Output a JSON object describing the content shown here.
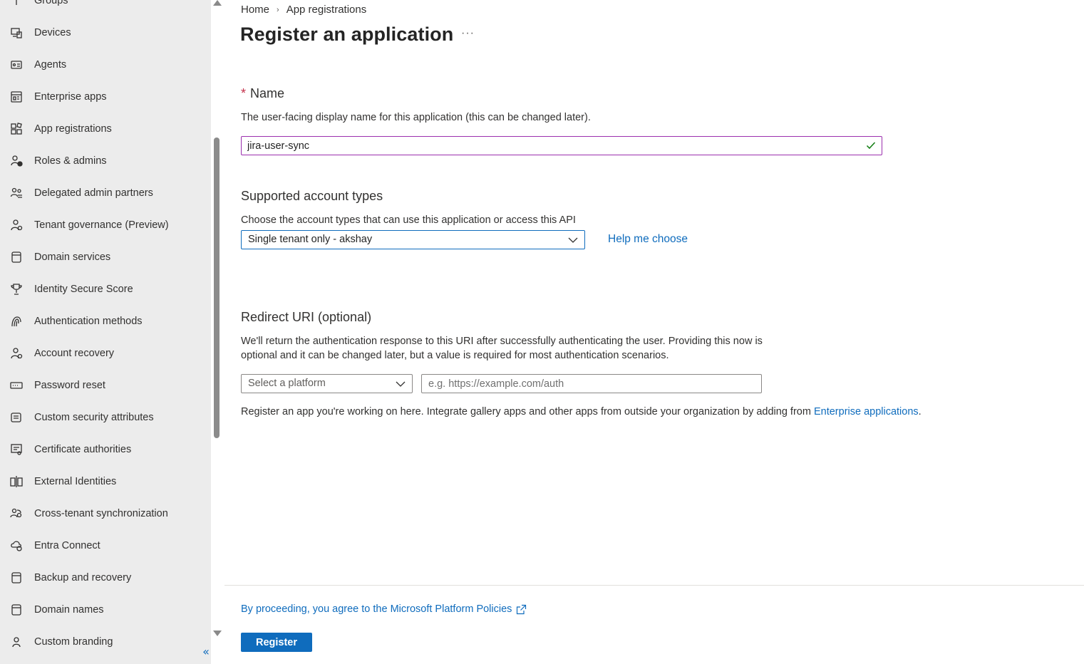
{
  "sidebar": {
    "items": [
      {
        "label": "Groups",
        "icon": "groups-icon"
      },
      {
        "label": "Devices",
        "icon": "devices-icon"
      },
      {
        "label": "Agents",
        "icon": "agents-icon"
      },
      {
        "label": "Enterprise apps",
        "icon": "enterprise-apps-icon"
      },
      {
        "label": "App registrations",
        "icon": "app-registrations-icon"
      },
      {
        "label": "Roles & admins",
        "icon": "roles-admins-icon"
      },
      {
        "label": "Delegated admin partners",
        "icon": "delegated-admin-icon"
      },
      {
        "label": "Tenant governance (Preview)",
        "icon": "tenant-governance-icon"
      },
      {
        "label": "Domain services",
        "icon": "domain-services-icon"
      },
      {
        "label": "Identity Secure Score",
        "icon": "trophy-icon"
      },
      {
        "label": "Authentication methods",
        "icon": "authentication-icon"
      },
      {
        "label": "Account recovery",
        "icon": "account-recovery-icon"
      },
      {
        "label": "Password reset",
        "icon": "password-reset-icon"
      },
      {
        "label": "Custom security attributes",
        "icon": "custom-attributes-icon"
      },
      {
        "label": "Certificate authorities",
        "icon": "certificate-icon"
      },
      {
        "label": "External Identities",
        "icon": "external-identities-icon"
      },
      {
        "label": "Cross-tenant synchronization",
        "icon": "cross-tenant-icon"
      },
      {
        "label": "Entra Connect",
        "icon": "entra-connect-icon"
      },
      {
        "label": "Backup and recovery",
        "icon": "backup-icon"
      },
      {
        "label": "Domain names",
        "icon": "domain-names-icon"
      },
      {
        "label": "Custom branding",
        "icon": "branding-icon"
      }
    ],
    "collapse_glyph": "«"
  },
  "breadcrumb": {
    "home": "Home",
    "separator": "›",
    "current": "App registrations"
  },
  "page": {
    "title": "Register an application",
    "more": "···"
  },
  "name_section": {
    "required_marker": "*",
    "heading": "Name",
    "description": "The user-facing display name for this application (this can be changed later).",
    "value": "jira-user-sync"
  },
  "account_section": {
    "heading": "Supported account types",
    "description": "Choose the account types that can use this application or access this API",
    "selected": "Single tenant only - akshay",
    "help_link": "Help me choose"
  },
  "redirect_section": {
    "heading": "Redirect URI (optional)",
    "description_line1": "We'll return the authentication response to this URI after successfully authenticating the user. Providing this now is",
    "description_line2": "optional and it can be changed later, but a value is required for most authentication scenarios.",
    "platform_placeholder": "Select a platform",
    "uri_placeholder": "e.g. https://example.com/auth"
  },
  "register_note": {
    "text": "Register an app you're working on here. Integrate gallery apps and other apps from outside your organization by adding from ",
    "link": "Enterprise applications",
    "suffix": "."
  },
  "footer": {
    "policy_text": "By proceeding, you agree to the Microsoft Platform Policies",
    "register_label": "Register"
  },
  "colors": {
    "accent": "#0f6cbd",
    "input_focus": "#9b2fae",
    "success": "#107c10",
    "required": "#c4314b",
    "sidebar_bg": "#ececec"
  }
}
